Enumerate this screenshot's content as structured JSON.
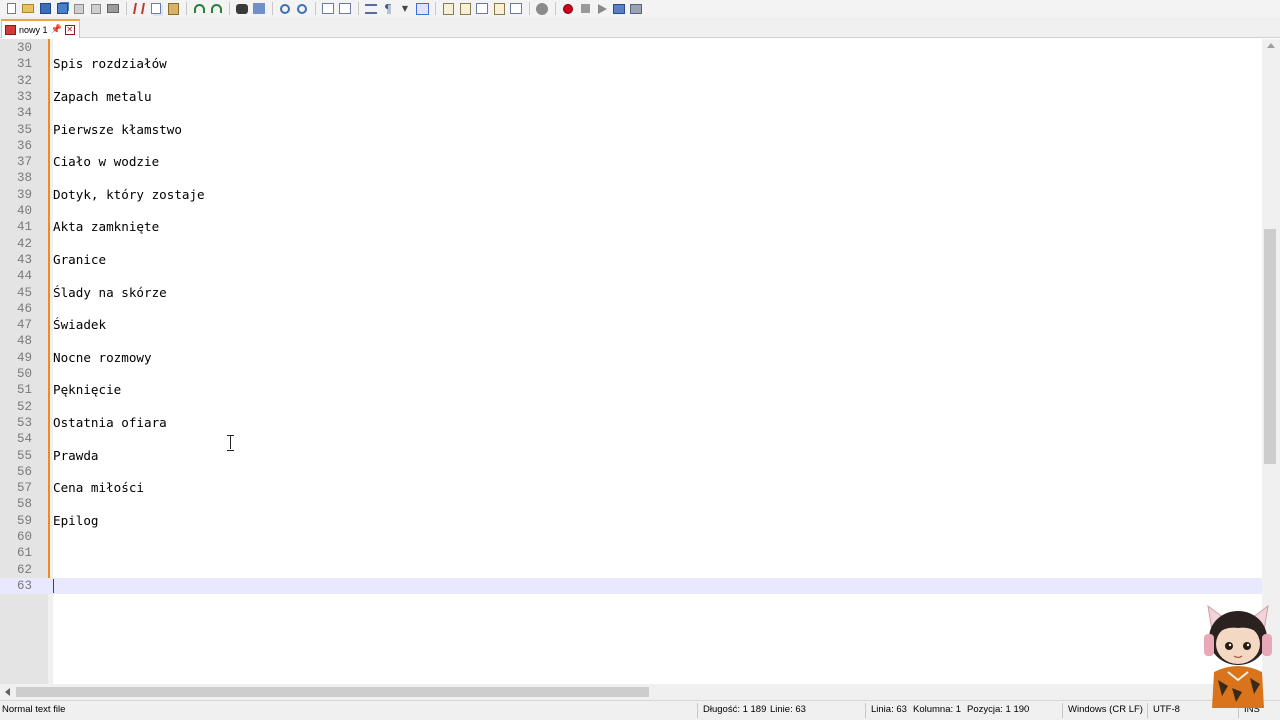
{
  "toolbar": {
    "buttons": [
      "new-file",
      "open-file",
      "save",
      "save-all",
      "close",
      "close-all",
      "print",
      "cut",
      "copy",
      "paste",
      "undo",
      "redo",
      "find",
      "replace",
      "zoom-in",
      "zoom-out",
      "sync-vertical",
      "sync-horizontal",
      "word-wrap",
      "show-all-characters",
      "indent-guide",
      "document-map",
      "function-list",
      "folder-as-workspace",
      "monitoring",
      "record-macro",
      "stop-recording",
      "playback-macro",
      "run-macro-multiple",
      "save-macro"
    ]
  },
  "tab": {
    "label": "nowy 1",
    "pin_glyph": "📌",
    "close_glyph": "✕"
  },
  "editor": {
    "lines": [
      {
        "n": "30",
        "text": ""
      },
      {
        "n": "31",
        "text": "Spis rozdziałów"
      },
      {
        "n": "32",
        "text": ""
      },
      {
        "n": "33",
        "text": "Zapach metalu"
      },
      {
        "n": "34",
        "text": ""
      },
      {
        "n": "35",
        "text": "Pierwsze kłamstwo"
      },
      {
        "n": "36",
        "text": ""
      },
      {
        "n": "37",
        "text": "Ciało w wodzie"
      },
      {
        "n": "38",
        "text": ""
      },
      {
        "n": "39",
        "text": "Dotyk, który zostaje"
      },
      {
        "n": "40",
        "text": ""
      },
      {
        "n": "41",
        "text": "Akta zamknięte"
      },
      {
        "n": "42",
        "text": ""
      },
      {
        "n": "43",
        "text": "Granice"
      },
      {
        "n": "44",
        "text": ""
      },
      {
        "n": "45",
        "text": "Ślady na skórze"
      },
      {
        "n": "46",
        "text": ""
      },
      {
        "n": "47",
        "text": "Świadek"
      },
      {
        "n": "48",
        "text": ""
      },
      {
        "n": "49",
        "text": "Nocne rozmowy"
      },
      {
        "n": "50",
        "text": ""
      },
      {
        "n": "51",
        "text": "Pęknięcie"
      },
      {
        "n": "52",
        "text": ""
      },
      {
        "n": "53",
        "text": "Ostatnia ofiara"
      },
      {
        "n": "54",
        "text": ""
      },
      {
        "n": "55",
        "text": "Prawda"
      },
      {
        "n": "56",
        "text": ""
      },
      {
        "n": "57",
        "text": "Cena miłości"
      },
      {
        "n": "58",
        "text": ""
      },
      {
        "n": "59",
        "text": "Epilog"
      },
      {
        "n": "60",
        "text": ""
      },
      {
        "n": "61",
        "text": ""
      },
      {
        "n": "62",
        "text": ""
      },
      {
        "n": "63",
        "text": ""
      }
    ],
    "current_line": "63"
  },
  "status": {
    "file_type": "Normal text file",
    "length": "Długość: 1 189",
    "lines": "Linie: 63",
    "line": "Linia: 63",
    "column": "Kolumna: 1",
    "position": "Pozycja: 1 190",
    "eol": "Windows (CR LF)",
    "encoding": "UTF-8",
    "mode": "INS"
  },
  "colors": {
    "current_line_bg": "#e8e8ff",
    "change_marker": "#f0891e",
    "caret": "#8000ff"
  }
}
